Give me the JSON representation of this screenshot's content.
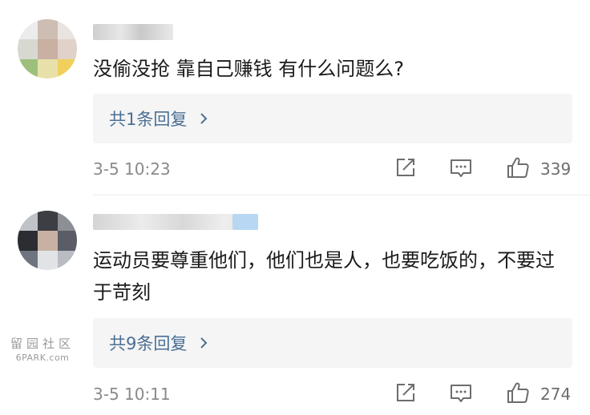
{
  "comments": [
    {
      "text": "没偷没抢 靠自己赚钱 有什么问题么?",
      "reply_label": "共1条回复",
      "timestamp": "3-5 10:23",
      "likes": "339"
    },
    {
      "text": "运动员要尊重他们，他们也是人，也要吃饭的，不要过于苛刻",
      "reply_label": "共9条回复",
      "timestamp": "3-5 10:11",
      "likes": "274"
    }
  ],
  "watermark": {
    "cn": "留园社区",
    "en": "6PARK.com"
  },
  "colors": {
    "reply_link": "#4a6f95",
    "meta_text": "#8a8a8a",
    "reply_bg": "#f5f5f5"
  }
}
